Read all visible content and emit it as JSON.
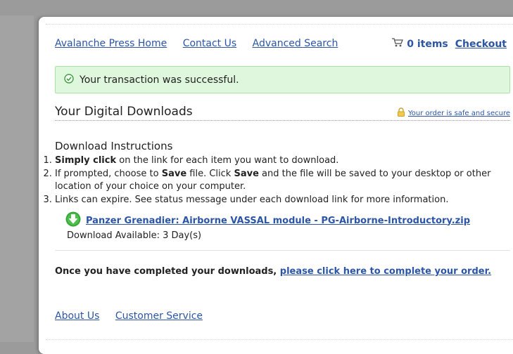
{
  "nav": {
    "home": "Avalanche Press Home",
    "contact": "Contact Us",
    "advanced_search": "Advanced Search"
  },
  "cart": {
    "items": "0 items",
    "checkout": "Checkout"
  },
  "alert": {
    "message": "Your transaction was successful."
  },
  "page": {
    "title": "Your Digital Downloads",
    "safe_link": "Your order is safe and secure"
  },
  "instructions": {
    "title": "Download Instructions",
    "step1_bold": "Simply click",
    "step1_rest": " on the link for each item you want to download.",
    "step2_a": "If prompted, choose to ",
    "step2_save1": "Save",
    "step2_b": " file. Click ",
    "step2_save2": "Save",
    "step2_c": " and the file will be saved to your desktop or other location of your choice on your computer.",
    "step3": "Links can expire. See status message under each download link for more information."
  },
  "download": {
    "link": "Panzer Grenadier: Airborne VASSAL module - PG-Airborne-Introductory.zip",
    "availability": "Download Available: 3 Day(s)"
  },
  "complete": {
    "text": "Once you have completed your downloads, ",
    "link": "please click here to complete your order."
  },
  "footer": {
    "about": "About Us",
    "service": "Customer Service"
  },
  "colors": {
    "link": "#2c55a6",
    "success_bg": "#dff7dc",
    "success_border": "#a9e3a3",
    "download_icon": "#3aa53a"
  }
}
